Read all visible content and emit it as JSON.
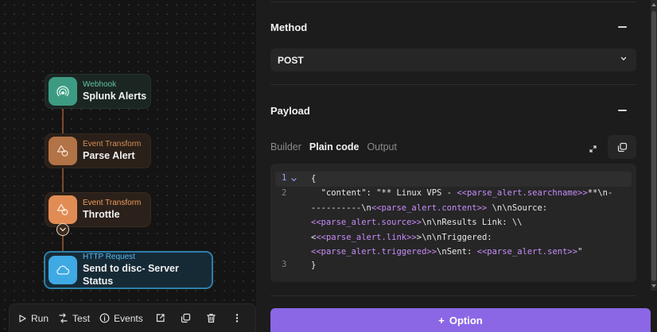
{
  "nodes": [
    {
      "type": "Webhook",
      "name": "Splunk Alerts",
      "icon": "webhook-icon"
    },
    {
      "type": "Event Transform",
      "name": "Parse Alert",
      "icon": "shapes-icon"
    },
    {
      "type": "Event Transform",
      "name": "Throttle",
      "icon": "shapes-icon"
    },
    {
      "type": "HTTP Request",
      "name": "Send to disc- Server Status",
      "icon": "cloud-icon"
    }
  ],
  "toolbar": {
    "run": "Run",
    "test": "Test",
    "events": "Events"
  },
  "method": {
    "title": "Method",
    "value": "POST"
  },
  "payload": {
    "title": "Payload",
    "tabs": [
      "Builder",
      "Plain code",
      "Output"
    ],
    "active_tab": "Plain code",
    "line_numbers": [
      "1",
      "2",
      "3"
    ],
    "code": {
      "open": "{",
      "l2a": "  \"content\": \"** Linux VPS - ",
      "l2b": "<<parse_alert.searchname>>",
      "l2c": "**\\n-",
      "l3a": "----------\\n",
      "l3b": "<<parse_alert.content>>",
      "l3c": " \\n\\nSource:",
      "l4a": "<<parse_alert.source>>",
      "l4b": "\\n\\nResults Link: \\\\",
      "l5a": "<",
      "l5b": "<<parse_alert.link>>",
      "l5c": ">\\n\\nTriggered:",
      "l6a": "<<parse_alert.triggered>>",
      "l6b": "\\nSent: ",
      "l6c": "<<parse_alert.sent>>",
      "l6d": "\"",
      "close": "}"
    }
  },
  "option_button": {
    "plus": "+",
    "label": "Option"
  },
  "colors": {
    "accent": "#8b67e6",
    "webhook": "#3d9b83",
    "transform": "#e28c55",
    "http": "#3fa9e4",
    "placeholder": "#c78dfa"
  }
}
